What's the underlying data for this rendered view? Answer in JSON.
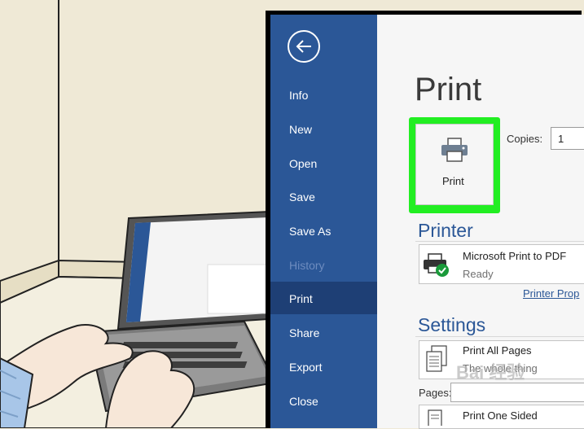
{
  "sidebar": {
    "items": [
      {
        "label": "Info",
        "disabled": false
      },
      {
        "label": "New",
        "disabled": false
      },
      {
        "label": "Open",
        "disabled": false
      },
      {
        "label": "Save",
        "disabled": false
      },
      {
        "label": "Save As",
        "disabled": false
      },
      {
        "label": "History",
        "disabled": true
      },
      {
        "label": "Print",
        "disabled": false,
        "selected": true
      },
      {
        "label": "Share",
        "disabled": false
      },
      {
        "label": "Export",
        "disabled": false
      },
      {
        "label": "Close",
        "disabled": false
      }
    ]
  },
  "main": {
    "title": "Print",
    "print_button_label": "Print",
    "copies_label": "Copies:",
    "copies_value": "1",
    "printer_section": "Printer",
    "printer_name": "Microsoft Print to PDF",
    "printer_status": "Ready",
    "printer_properties_link": "Printer Prop",
    "settings_section": "Settings",
    "settings_pages_title": "Print All Pages",
    "settings_pages_sub": "The whole thing",
    "pages_label": "Pages:",
    "sided_title": "Print One Sided"
  },
  "watermark": "Bai 经验",
  "colors": {
    "sidebar": "#2b5797",
    "sidebar_selected": "#1e3f75",
    "highlight": "#22ee22",
    "accent_text": "#2b5797"
  },
  "icons": [
    "back-arrow-icon",
    "printer-icon",
    "pdf-printer-icon",
    "ready-check-icon",
    "pages-icon",
    "one-sided-icon"
  ]
}
